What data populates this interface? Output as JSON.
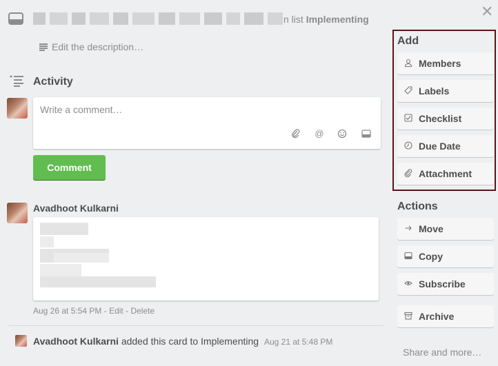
{
  "header": {
    "list_prefix": "n list",
    "list_name": "Implementing",
    "close_glyph": "✕"
  },
  "description": {
    "edit_link": "Edit the description…"
  },
  "activity": {
    "title": "Activity",
    "comment_placeholder": "Write a comment…",
    "comment_button": "Comment",
    "composer_icons": [
      "paperclip-icon",
      "mention-icon",
      "emoji-icon",
      "card-icon"
    ]
  },
  "comments": [
    {
      "author": "Avadhoot Kulkarni",
      "date": "Aug 26 at 5:54 PM",
      "sep1": " - ",
      "edit": "Edit",
      "sep2": " - ",
      "delete": "Delete"
    }
  ],
  "log": {
    "author": "Avadhoot Kulkarni",
    "action": "added this card to Implementing",
    "date": "Aug 21 at 5:48 PM"
  },
  "sidebar": {
    "add_heading": "Add",
    "add_items": [
      {
        "label": "Members",
        "icon": "person-icon"
      },
      {
        "label": "Labels",
        "icon": "tag-icon"
      },
      {
        "label": "Checklist",
        "icon": "checkbox-icon"
      },
      {
        "label": "Due Date",
        "icon": "clock-icon"
      },
      {
        "label": "Attachment",
        "icon": "paperclip-icon"
      }
    ],
    "actions_heading": "Actions",
    "action_items": [
      {
        "label": "Move",
        "icon": "arrow-right-icon"
      },
      {
        "label": "Copy",
        "icon": "card-icon"
      },
      {
        "label": "Subscribe",
        "icon": "eye-icon"
      },
      {
        "label": "Archive",
        "icon": "archive-icon"
      }
    ],
    "share_more": "Share and more…"
  },
  "colors": {
    "background": "#edeff0",
    "comment_button": "#61bd4f",
    "add_highlight_border": "#5b1414"
  }
}
